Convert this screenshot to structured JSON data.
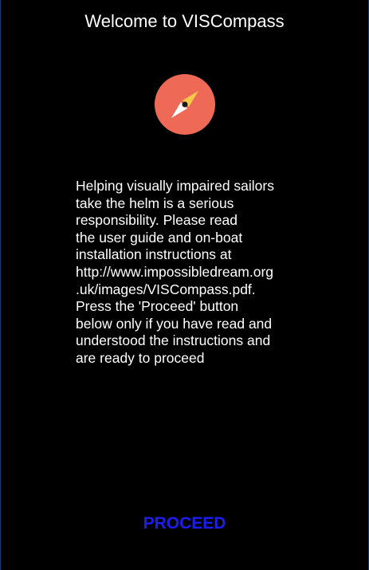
{
  "app": {
    "title": "Welcome to VISCompass",
    "logo_icon": "compass-icon"
  },
  "message": {
    "lines": [
      "Helping visually impaired sailors",
      "take the helm is a serious",
      "responsibility. Please read",
      "the user guide and on-boat",
      "installation instructions at",
      "http://www.impossibledream.org",
      ".uk/images/VISCompass.pdf.",
      "Press the 'Proceed' button",
      "below only if you have read and",
      "understood the instructions and",
      "are ready to proceed"
    ]
  },
  "actions": {
    "proceed_label": "PROCEED"
  },
  "colors": {
    "background": "#000000",
    "text": "#ffffff",
    "logo_circle": "#ee6a57",
    "logo_needle_north": "#f7c948",
    "logo_needle_south": "#ffffff",
    "button_text": "#1d1df0"
  }
}
